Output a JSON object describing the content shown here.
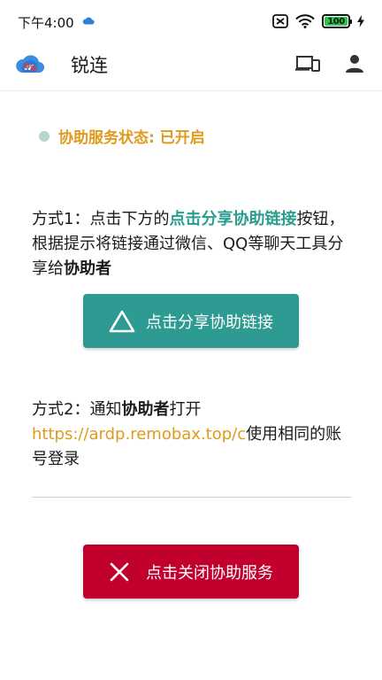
{
  "status_bar": {
    "time": "下午4:00",
    "battery": "100"
  },
  "app_bar": {
    "title": "锐连"
  },
  "service": {
    "status": "协助服务状态: 已开启"
  },
  "method1": {
    "prefix": "方式1：点击下方的",
    "highlight": "点击分享协助链接",
    "middle": "按钮，根据提示将链接通过微信、QQ等聊天工具分享给",
    "bold": "协助者"
  },
  "share_button": {
    "label": "点击分享协助链接"
  },
  "method2": {
    "prefix": "方式2：通知",
    "bold": "协助者",
    "middle": "打开",
    "link": "https://ardp.remobax.top/c",
    "suffix": "使用相同的账号登录"
  },
  "close_button": {
    "label": "点击关闭协助服务"
  },
  "colors": {
    "accent_teal": "#2d9b92",
    "accent_orange": "#e09a1d",
    "danger_red": "#c1002e"
  },
  "icons": [
    "cloud-icon",
    "nfc-icon",
    "wifi-icon",
    "battery-icon",
    "charging-icon",
    "devices-icon",
    "account-icon",
    "share-triangle-icon",
    "close-icon"
  ]
}
